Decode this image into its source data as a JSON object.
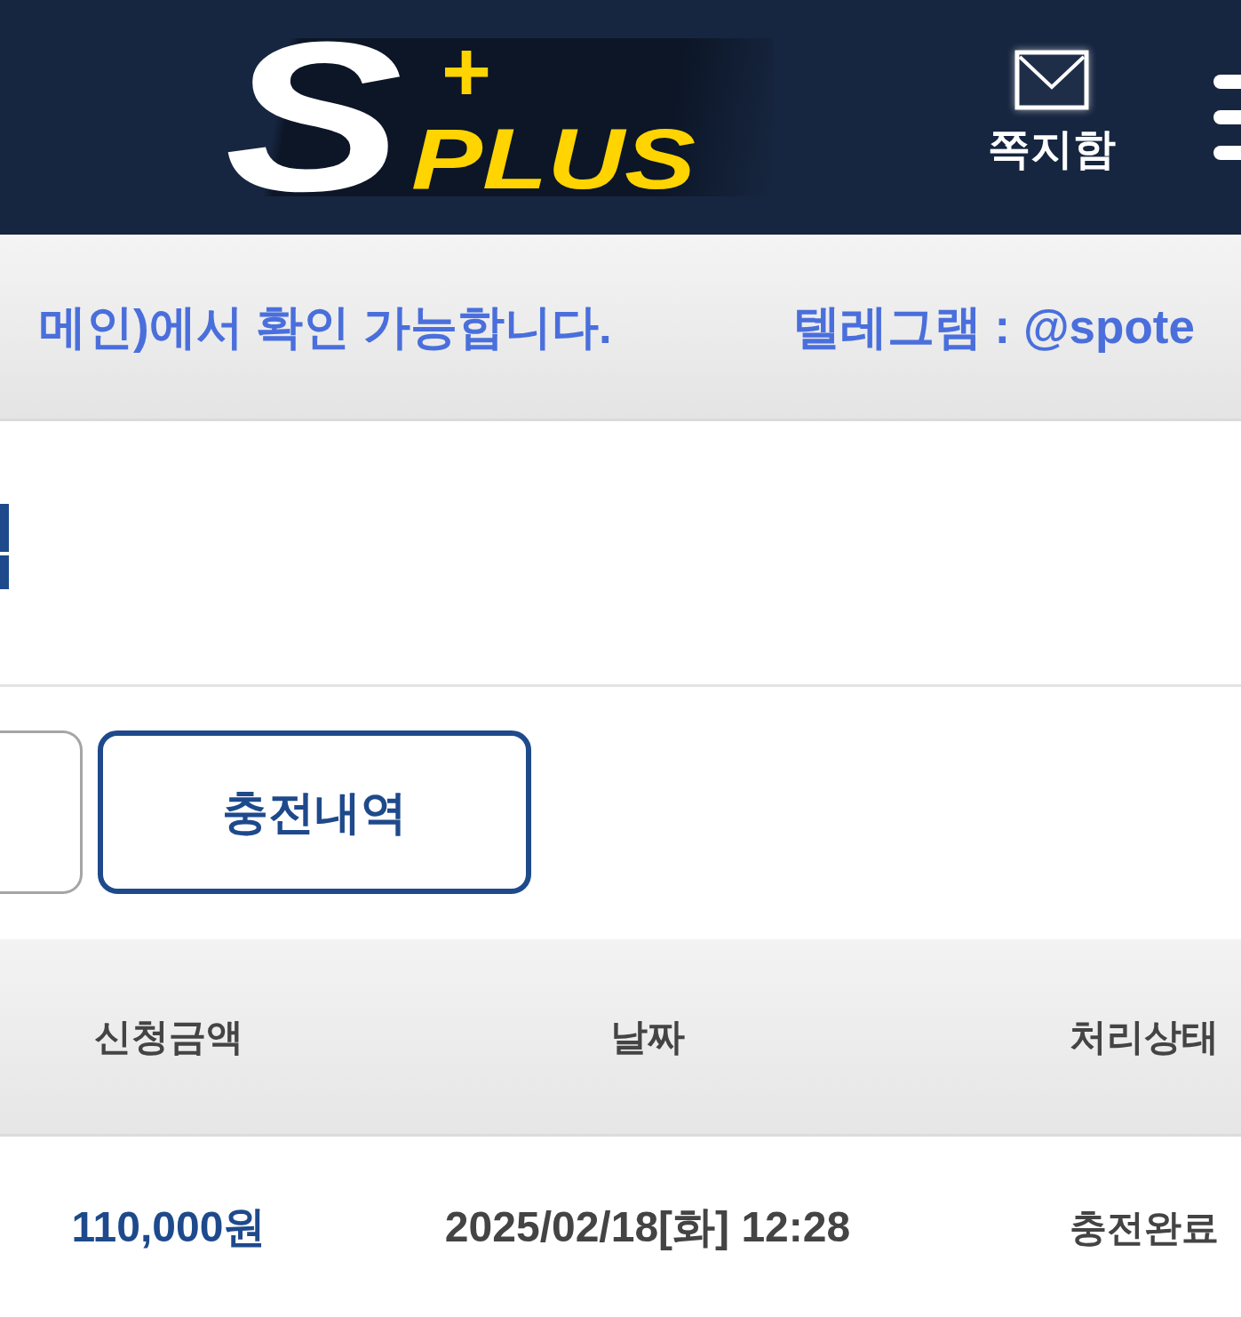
{
  "header": {
    "logo": {
      "letter": "S",
      "mark": "+",
      "word": "PLUS"
    },
    "messages": {
      "label": "쪽지함"
    }
  },
  "notice": {
    "items": [
      "메인)에서 확인 가능합니다.",
      "텔레그램 : @spote"
    ]
  },
  "tabs": [
    {
      "selected": false
    },
    {
      "label": "충전내역",
      "selected": true
    }
  ],
  "table": {
    "columns": [
      "신청금액",
      "날짜",
      "처리상태"
    ],
    "rows": [
      {
        "amount": "110,000원",
        "date": "2025/02/18[화] 12:28",
        "status": "충전완료"
      }
    ]
  }
}
